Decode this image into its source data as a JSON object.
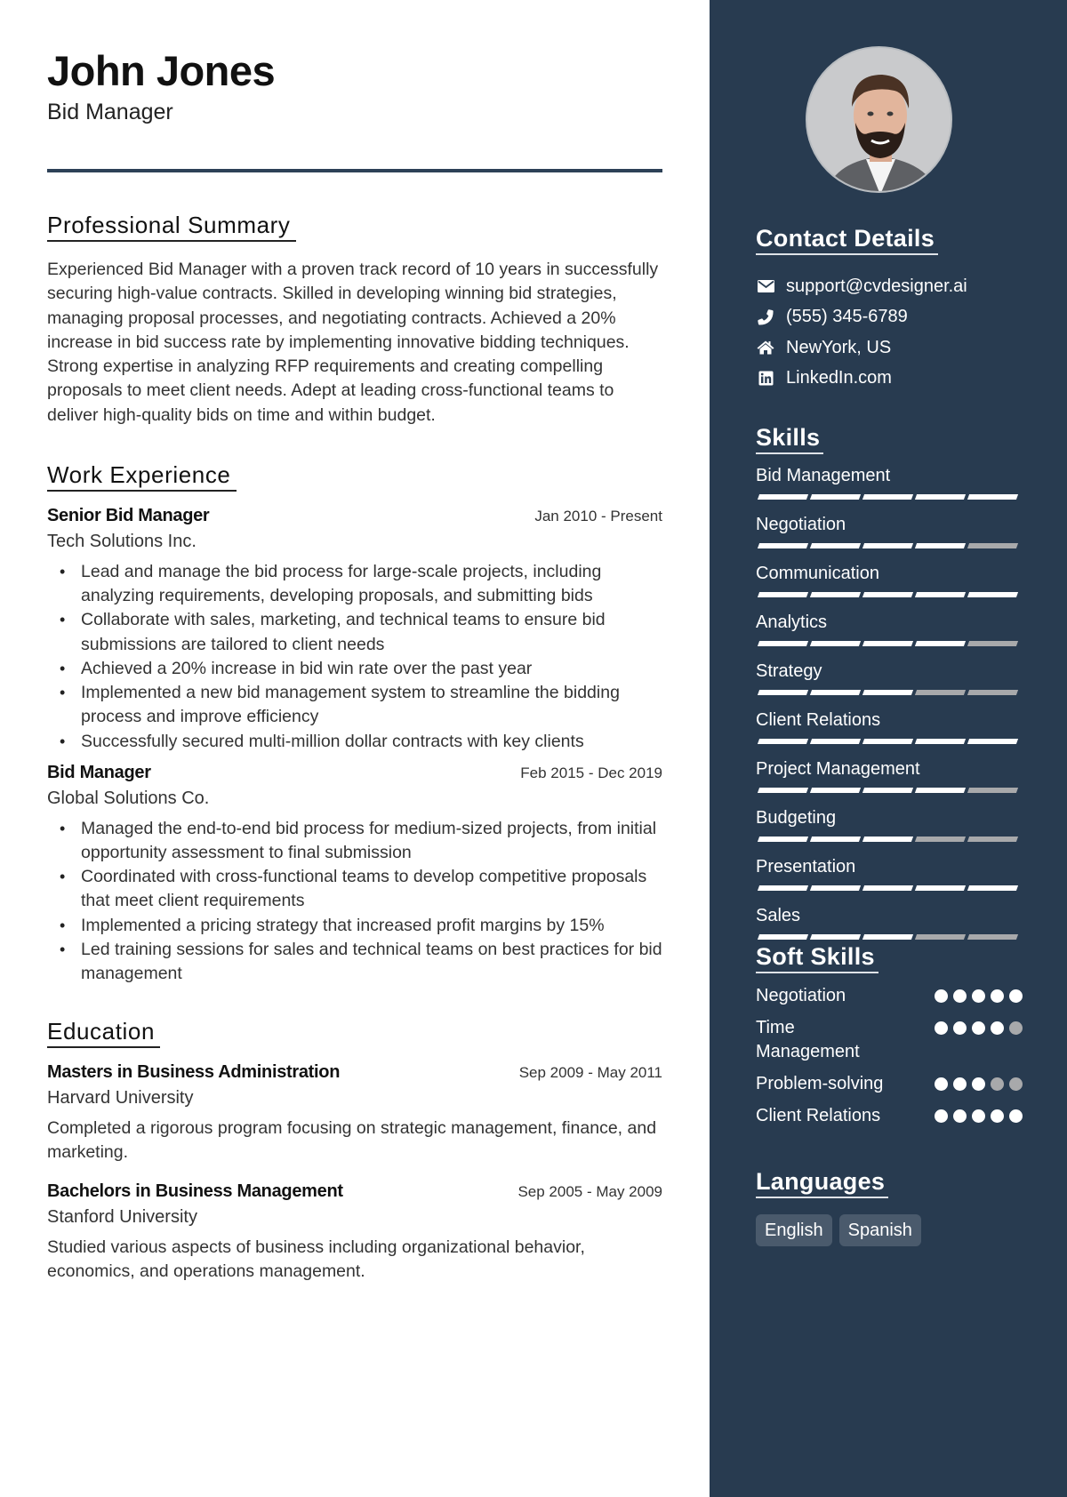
{
  "header": {
    "name": "John Jones",
    "title": "Bid Manager"
  },
  "summary": {
    "heading": "Professional Summary",
    "text": "Experienced Bid Manager with a proven track record of 10 years in successfully securing high-value contracts. Skilled in developing winning bid strategies, managing proposal processes, and negotiating contracts. Achieved a 20% increase in bid success rate by implementing innovative bidding techniques. Strong expertise in analyzing RFP requirements and creating compelling proposals to meet client needs. Adept at leading cross-functional teams to deliver high-quality bids on time and within budget."
  },
  "experience": {
    "heading": "Work Experience",
    "jobs": [
      {
        "title": "Senior Bid Manager",
        "dates": "Jan 2010 - Present",
        "company": "Tech Solutions Inc.",
        "bullets": [
          "Lead and manage the bid process for large-scale projects, including analyzing requirements, developing proposals, and submitting bids",
          "Collaborate with sales, marketing, and technical teams to ensure bid submissions are tailored to client needs",
          "Achieved a 20% increase in bid win rate over the past year",
          "Implemented a new bid management system to streamline the bidding process and improve efficiency",
          "Successfully secured multi-million dollar contracts with key clients"
        ]
      },
      {
        "title": "Bid Manager",
        "dates": "Feb 2015 - Dec 2019",
        "company": "Global Solutions Co.",
        "bullets": [
          "Managed the end-to-end bid process for medium-sized projects, from initial opportunity assessment to final submission",
          "Coordinated with cross-functional teams to develop competitive proposals that meet client requirements",
          "Implemented a pricing strategy that increased profit margins by 15%",
          "Led training sessions for sales and technical teams on best practices for bid management"
        ]
      }
    ]
  },
  "education": {
    "heading": "Education",
    "items": [
      {
        "degree": "Masters in Business Administration",
        "dates": "Sep 2009 - May 2011",
        "school": "Harvard University",
        "description": "Completed a rigorous program focusing on strategic management, finance, and marketing."
      },
      {
        "degree": "Bachelors in Business Management",
        "dates": "Sep 2005 - May 2009",
        "school": "Stanford University",
        "description": "Studied various aspects of business including organizational behavior, economics, and operations management."
      }
    ]
  },
  "sidebar": {
    "photo_alt": "profile-photo",
    "contact": {
      "heading": "Contact Details",
      "items": [
        {
          "icon": "envelope-icon",
          "value": "support@cvdesigner.ai"
        },
        {
          "icon": "phone-icon",
          "value": "(555) 345-6789"
        },
        {
          "icon": "home-icon",
          "value": "NewYork, US"
        },
        {
          "icon": "linkedin-icon",
          "value": "LinkedIn.com"
        }
      ]
    },
    "skills": {
      "heading": "Skills",
      "max": 5,
      "items": [
        {
          "name": "Bid Management",
          "level": 5
        },
        {
          "name": "Negotiation",
          "level": 4
        },
        {
          "name": "Communication",
          "level": 5
        },
        {
          "name": "Analytics",
          "level": 4
        },
        {
          "name": "Strategy",
          "level": 3
        },
        {
          "name": "Client Relations",
          "level": 5
        },
        {
          "name": "Project Management",
          "level": 4
        },
        {
          "name": "Budgeting",
          "level": 3
        },
        {
          "name": "Presentation",
          "level": 5
        },
        {
          "name": "Sales",
          "level": 3
        }
      ]
    },
    "soft_skills": {
      "heading": "Soft Skills",
      "max": 5,
      "items": [
        {
          "name": "Negotiation",
          "level": 5
        },
        {
          "name": "Time Management",
          "level": 4
        },
        {
          "name": "Problem-solving",
          "level": 3
        },
        {
          "name": "Client Relations",
          "level": 5
        }
      ]
    },
    "languages": {
      "heading": "Languages",
      "items": [
        "English",
        "Spanish"
      ]
    }
  },
  "colors": {
    "sidebar_bg": "#283b50",
    "divider": "#2d4157",
    "bar_on": "#ffffff",
    "bar_off": "#a8a9ab",
    "badge_bg": "#4a5a6c"
  }
}
